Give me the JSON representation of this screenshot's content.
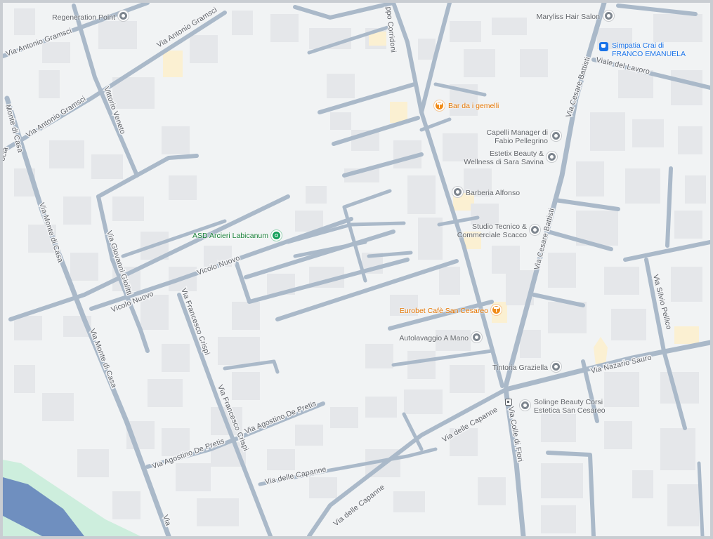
{
  "map": {
    "colors": {
      "background": "#f1f3f4",
      "road": "#aab9c9",
      "building": "#e5e7ea",
      "highlight_building": "#fbf0d2",
      "water": "#6f8fbf",
      "park": "#cdeedd"
    },
    "streets": {
      "via_antonio_gramsci_a": "Via Antonio Gramsci",
      "via_antonio_gramsci_b": "Via Antonio Gramsci",
      "via_antonio_gramsci_c": "Via Antonio Gramsci",
      "via_monte_di_casa_a": "Via Monte di Casa",
      "via_monte_di_casa_b": "Via Monte di Casa",
      "via_monte_di_casa_c": "Monte di Casa",
      "via_monte_di_casa_d": "ecia",
      "via_giovanni_giolitti": "Via Giovanni Giolitti",
      "via_vittorio_veneto": "Vittorio Veneto",
      "vicolo_nuovo_a": "Vicolo Nuovo",
      "vicolo_nuovo_b": "Vicolo Nuovo",
      "via_francesco_crispi_a": "Via Francesco Crispi",
      "via_francesco_crispi_b": "Via Francesco Crispi",
      "via_agostino_de_pretis_a": "Via Agostino De Pretis",
      "via_agostino_de_pretis_b": "Via Agostino De Pretis",
      "via_delle_capanne_a": "Via delle Capanne",
      "via_delle_capanne_b": "Via delle Capanne",
      "via_delle_capanne_c": "Via delle Capanne",
      "via_colle_di_fiori": "Via Colle di Fiori",
      "via_cesare_battisti_a": "Via Cesare Battisti",
      "via_cesare_battisti_b": "Via Cesare Battisti",
      "viale_del_lavoro": "Viale del Lavoro",
      "via_silvio_pellico": "Via Silvio Pellico",
      "via_nazario_sauro": "Via Nazario Sauro",
      "filippo_corridoni": "ppo Corridoni",
      "via_edge": "Via"
    },
    "places": [
      {
        "id": "regeneration-point",
        "lines": [
          "Regeneration Point"
        ],
        "type": "gray"
      },
      {
        "id": "maryliss-hair-salon",
        "lines": [
          "Maryliss Hair Salon"
        ],
        "type": "gray"
      },
      {
        "id": "simpatia-crai",
        "lines": [
          "Simpatia Crai di",
          "FRANCO EMANUELA"
        ],
        "type": "blue"
      },
      {
        "id": "bar-da-i-gemelli",
        "lines": [
          "Bar da i gemelli"
        ],
        "type": "orange"
      },
      {
        "id": "capelli-manager",
        "lines": [
          "Capelli Manager di",
          "Fabio Pellegrino"
        ],
        "type": "gray"
      },
      {
        "id": "estetix-beauty",
        "lines": [
          "Estetix Beauty &",
          "Wellness di Sara Savina"
        ],
        "type": "gray"
      },
      {
        "id": "barberia-alfonso",
        "lines": [
          "Barberia Alfonso"
        ],
        "type": "gray"
      },
      {
        "id": "asd-arcieri",
        "lines": [
          "ASD Arcieri Labicanum"
        ],
        "type": "green"
      },
      {
        "id": "studio-tecnico",
        "lines": [
          "Studio Tecnico &",
          "Commerciale Scacco"
        ],
        "type": "gray"
      },
      {
        "id": "eurobet-cafe",
        "lines": [
          "Eurobet Cafè San Cesareo"
        ],
        "type": "orange"
      },
      {
        "id": "autolavaggio",
        "lines": [
          "Autolavaggio A Mano"
        ],
        "type": "gray"
      },
      {
        "id": "tintoria-graziella",
        "lines": [
          "Tintoria Graziella"
        ],
        "type": "gray"
      },
      {
        "id": "solinge-beauty",
        "lines": [
          "Solinge Beauty Corsi",
          "Estetica San Cesareo"
        ],
        "type": "gray"
      }
    ]
  }
}
